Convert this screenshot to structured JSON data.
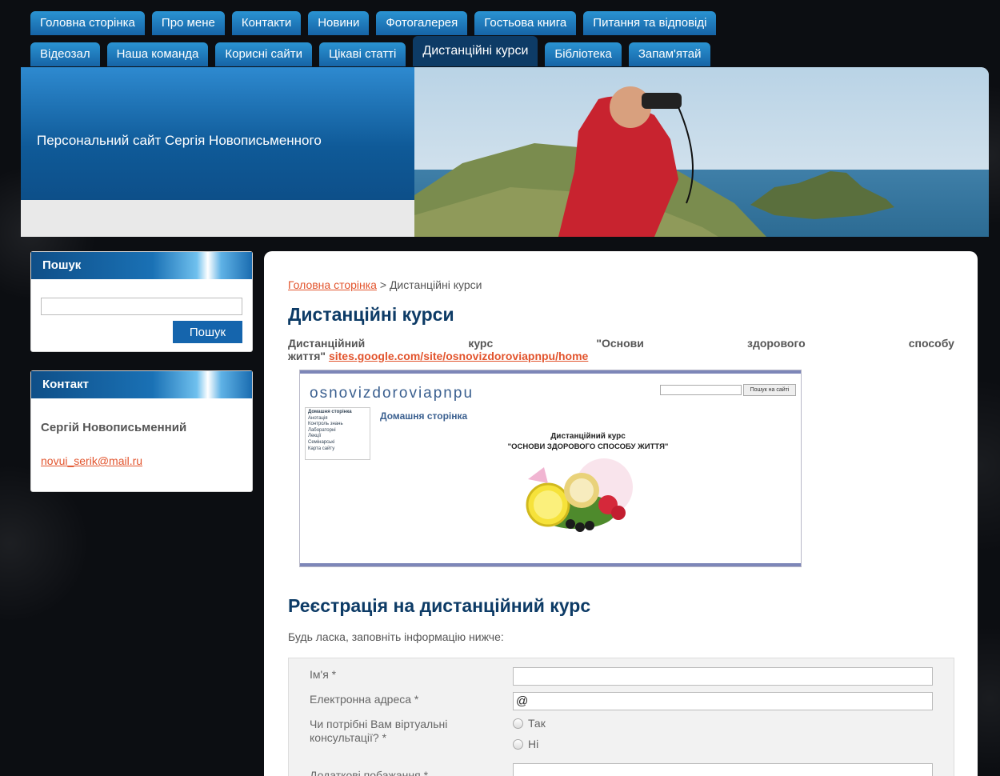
{
  "nav": {
    "row1": [
      "Головна сторінка",
      "Про мене",
      "Контакти",
      "Новини",
      "Фотогалерея",
      "Гостьова книга",
      "Питання та відповіді"
    ],
    "row2": [
      "Відеозал",
      "Наша команда",
      "Корисні сайти",
      "Цікаві статті",
      "Дистанційні курси",
      "Бібліотека",
      "Запам'ятай"
    ],
    "active": "Дистанційні курси"
  },
  "header": {
    "title": "Персональний сайт Сергія Новописьменного"
  },
  "sidebar": {
    "search": {
      "title": "Пошук",
      "input_value": "",
      "button": "Пошук"
    },
    "contact": {
      "title": "Контакт",
      "name": "Сергій Новописьменний",
      "email": "novui_serik@mail.ru"
    }
  },
  "main": {
    "breadcrumb": {
      "home": "Головна сторінка",
      "sep": ">",
      "current": "Дистанційні курси"
    },
    "title": "Дистанційні курси",
    "intro_words": [
      "Дистанційний",
      "курс",
      "\"Основи",
      "здорового",
      "способу"
    ],
    "intro_last": "життя\"",
    "intro_link": "sites.google.com/site/osnovizdoroviapnpu/home",
    "embedded": {
      "site_title": "osnovizdoroviapnpu",
      "search_button": "Пошук на сайті",
      "nav": [
        "Домашня сторінка",
        "Анотація",
        "Контроль знань",
        "Лабораторні",
        "Лекції",
        "Семінарські",
        "Карта сайту"
      ],
      "page_heading": "Домашня сторінка",
      "course_line1": "Дистанційний курс",
      "course_line2": "\"ОСНОВИ ЗДОРОВОГО СПОСОБУ ЖИТТЯ\""
    },
    "reg_title": "Реєстрація на дистанційний курс",
    "reg_hint": "Будь ласка, заповніть інформацію нижче:",
    "form": {
      "name_label": "Ім'я *",
      "name_value": "",
      "email_label": "Електронна адреса *",
      "email_value": "@",
      "consult_label_1": "Чи потрібні Вам віртуальні",
      "consult_label_2": "консультації? *",
      "opt_yes": "Так",
      "opt_no": "Ні",
      "wishes_label": "Додаткові побажання *",
      "wishes_value": ""
    }
  },
  "colors": {
    "accent": "#0d3b66",
    "tab": "#1f7fc2",
    "link": "#e2542d"
  }
}
